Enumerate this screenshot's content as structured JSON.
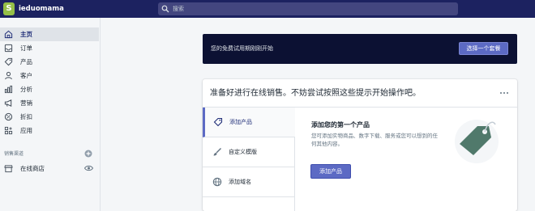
{
  "topbar": {
    "store_initial": "S",
    "store_name": "ieduomama",
    "search_placeholder": "搜索"
  },
  "sidebar": {
    "items": [
      {
        "label": "主页",
        "icon": "home-icon"
      },
      {
        "label": "订单",
        "icon": "orders-icon"
      },
      {
        "label": "产品",
        "icon": "tag-icon"
      },
      {
        "label": "客户",
        "icon": "person-icon"
      },
      {
        "label": "分析",
        "icon": "bar-chart-icon"
      },
      {
        "label": "营销",
        "icon": "megaphone-icon"
      },
      {
        "label": "折扣",
        "icon": "discount-icon"
      },
      {
        "label": "应用",
        "icon": "apps-icon"
      }
    ],
    "active_index": 0,
    "sales_channels_title": "销售渠道",
    "channel": {
      "label": "在线商店",
      "icon": "store-icon"
    }
  },
  "banner": {
    "text": "您的免费试用期刚刚开始",
    "button_label": "选择一个套餐"
  },
  "setup_card": {
    "title": "准备好进行在线销售。不妨尝试按照这些提示开始操作吧。",
    "tabs": [
      {
        "label": "添加产品",
        "icon": "tag-icon"
      },
      {
        "label": "自定义模版",
        "icon": "brush-icon"
      },
      {
        "label": "添加域名",
        "icon": "globe-icon"
      }
    ],
    "active_tab": 0,
    "content_title": "添加您的第一个产品",
    "content_description": "您可添加实物商品、数字下载、服务或您可以想到的任何其他内容。",
    "content_button": "添加产品"
  },
  "colors": {
    "topbar": "#1c2260",
    "banner": "#0c1133",
    "accent": "#5c6ac4",
    "logo_green": "#95bf47",
    "illustration_circle": "#f4f6f8",
    "illustration_tag": "#50796b"
  }
}
